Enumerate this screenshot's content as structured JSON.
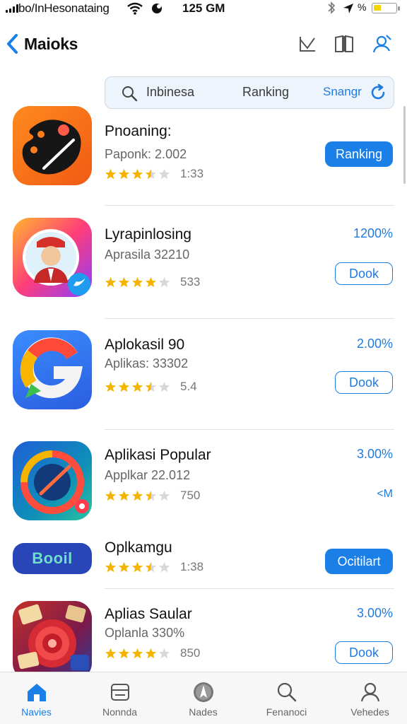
{
  "status_bar": {
    "carrier": "bo/InHesonataing",
    "time": "125 GM",
    "battery_pct_label": "%"
  },
  "nav": {
    "back_label": "Maioks"
  },
  "segment_bar": {
    "item_1": "Inbinesa",
    "item_2": "Ranking",
    "item_3": "Snangr"
  },
  "apps": [
    {
      "name": "Pnoaning:",
      "subtitle": "Paponk: 2.002",
      "rating": 3.5,
      "rating_count": "1:33",
      "action": "Ranking"
    },
    {
      "name": "Lyrapinlosing",
      "subtitle": "Aprasila 32210",
      "rating": 4,
      "rating_count": "533",
      "price": "1200%",
      "action": "Dook"
    },
    {
      "name": "Aplokasil 90",
      "subtitle": "Aplikas: 33302",
      "rating": 3.5,
      "rating_count": "5.4",
      "price": "2.00%",
      "action": "Dook"
    },
    {
      "name": "Aplikasi Popular",
      "subtitle": "Applkar 22.012",
      "rating": 3.5,
      "rating_count": "750",
      "price": "3.00%",
      "action": "<M"
    },
    {
      "name": "Oplkamgu",
      "banner": "Booil",
      "rating": 3.5,
      "rating_count": "1:38",
      "action": "Ocitilart"
    },
    {
      "name": "Aplias Saular",
      "subtitle": "Oplanla 330%",
      "rating": 4,
      "rating_count": "850",
      "price": "3.00%",
      "action": "Dook"
    }
  ],
  "tabs": [
    {
      "label": "Navies",
      "icon": "home-icon",
      "active": true
    },
    {
      "label": "Nonnda",
      "icon": "card-icon",
      "active": false
    },
    {
      "label": "Nades",
      "icon": "compass-icon",
      "active": false
    },
    {
      "label": "Fenanoci",
      "icon": "search-icon",
      "active": false
    },
    {
      "label": "Vehedes",
      "icon": "person-icon",
      "active": false
    }
  ],
  "colors": {
    "accent": "#1a7fe6",
    "star": "#f5b400",
    "banner": "#2846b8"
  }
}
